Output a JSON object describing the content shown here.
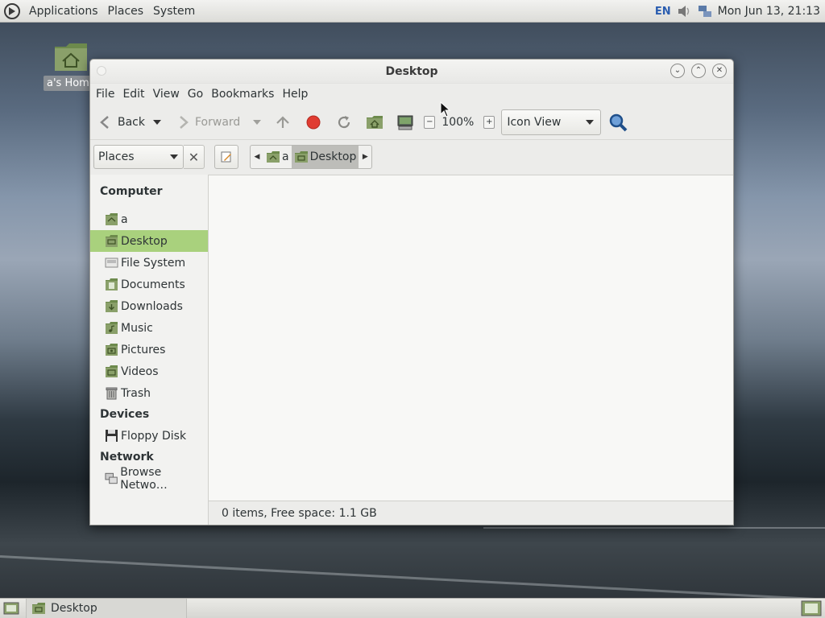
{
  "top_panel": {
    "menus": [
      "Applications",
      "Places",
      "System"
    ],
    "lang": "EN",
    "clock": "Mon Jun 13, 21:13"
  },
  "desktop": {
    "home_icon_label": "a's Home"
  },
  "window": {
    "title": "Desktop",
    "menubar": [
      "File",
      "Edit",
      "View",
      "Go",
      "Bookmarks",
      "Help"
    ],
    "toolbar": {
      "back_label": "Back",
      "forward_label": "Forward",
      "zoom": "100%",
      "view_mode": "Icon View"
    },
    "location": {
      "places_label": "Places",
      "breadcrumbs": [
        "a",
        "Desktop"
      ]
    },
    "sidebar": {
      "sections": [
        {
          "heading": "Computer",
          "items": [
            "a",
            "Desktop",
            "File System",
            "Documents",
            "Downloads",
            "Music",
            "Pictures",
            "Videos",
            "Trash"
          ]
        },
        {
          "heading": "Devices",
          "items": [
            "Floppy Disk"
          ]
        },
        {
          "heading": "Network",
          "items": [
            "Browse Netwo…"
          ]
        }
      ],
      "selected": "Desktop"
    },
    "status": "0 items, Free space: 1.1 GB"
  },
  "bottom_panel": {
    "task_label": "Desktop"
  },
  "colors": {
    "selection": "#a9d17d",
    "folder_green": "#8aa06a"
  }
}
